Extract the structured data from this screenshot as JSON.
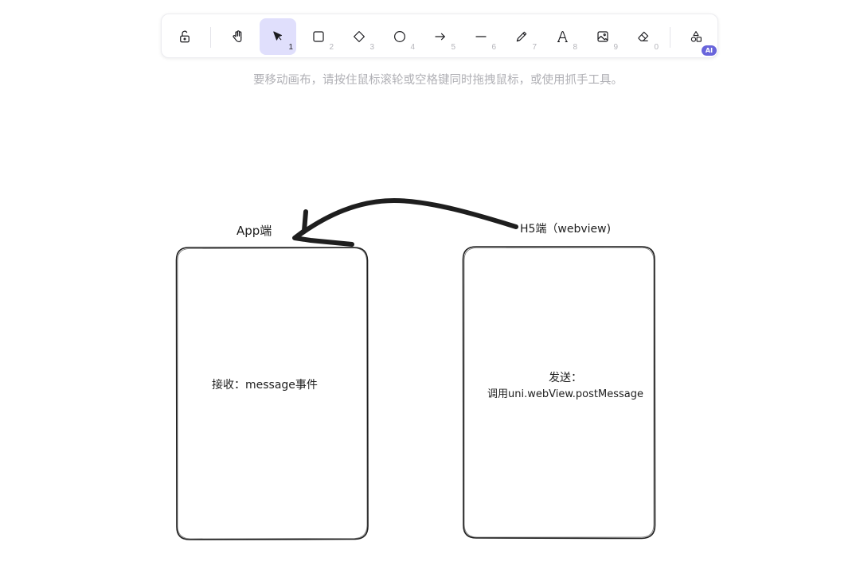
{
  "toolbar": {
    "tools": [
      {
        "name": "lock-icon",
        "key": ""
      },
      {
        "name": "hand-icon",
        "key": ""
      },
      {
        "name": "selection-icon",
        "key": "1"
      },
      {
        "name": "rectangle-icon",
        "key": "2"
      },
      {
        "name": "diamond-icon",
        "key": "3"
      },
      {
        "name": "ellipse-icon",
        "key": "4"
      },
      {
        "name": "arrow-icon",
        "key": "5"
      },
      {
        "name": "line-icon",
        "key": "6"
      },
      {
        "name": "pencil-icon",
        "key": "7"
      },
      {
        "name": "text-icon",
        "key": "8"
      },
      {
        "name": "image-icon",
        "key": "9"
      },
      {
        "name": "eraser-icon",
        "key": "0"
      },
      {
        "name": "shapes-icon",
        "key": ""
      }
    ],
    "active_tool": "selection-icon",
    "ai_badge": "AI",
    "accent_color": "#6965db",
    "active_bg": "#e0dffc"
  },
  "hint": "要移动画布，请按住鼠标滚轮或空格键同时拖拽鼠标，或使用抓手工具。",
  "canvas": {
    "app_title": "App端",
    "h5_title": "H5端（webview)",
    "app_box_text": "接收：message事件",
    "h5_box_line1": "发送：",
    "h5_box_line2": "调用uni.webView.postMessage"
  }
}
